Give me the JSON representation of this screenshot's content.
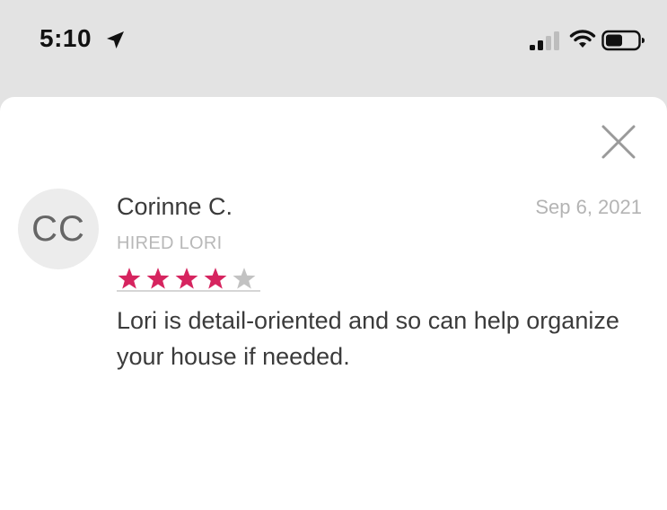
{
  "status_bar": {
    "time": "5:10"
  },
  "review": {
    "avatar_initials": "CC",
    "reviewer_name": "Corinne C.",
    "date": "Sep 6, 2021",
    "hired_label": "HIRED LORI",
    "rating": 4,
    "rating_max": 5,
    "text": "Lori is detail-oriented and so can help organize your house if needed."
  },
  "colors": {
    "star_filled": "#d6245f",
    "star_empty": "#c2c2c2",
    "backdrop": "#e3e3e3",
    "sheet": "#ffffff"
  },
  "icons": [
    "location-arrow-icon",
    "cellular-signal-icon",
    "wifi-icon",
    "battery-icon",
    "close-icon",
    "star-icon"
  ]
}
